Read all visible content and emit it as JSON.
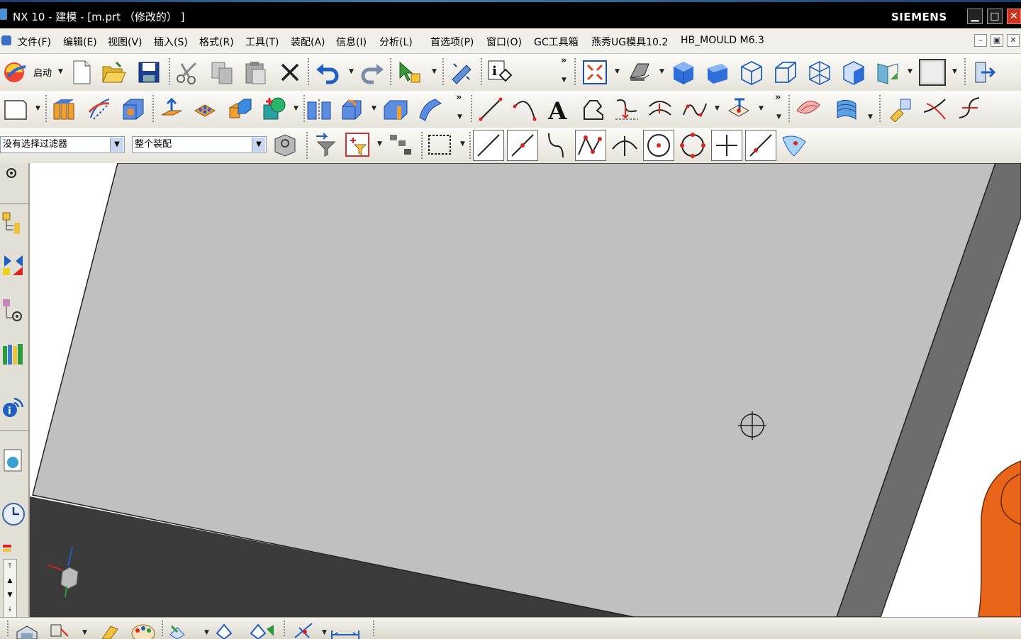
{
  "window": {
    "title": "NX 10 - 建模 - [m.prt （修改的） ]",
    "brand": "SIEMENS",
    "controls": [
      "minimize",
      "maximize",
      "close"
    ]
  },
  "menu": {
    "items": [
      "文件(F)",
      "编辑(E)",
      "视图(V)",
      "插入(S)",
      "格式(R)",
      "工具(T)",
      "装配(A)",
      "信息(I)",
      "分析(L)",
      "首选项(P)",
      "窗口(O)",
      "GC工具箱",
      "燕秀UG模具10.2",
      "HB_MOULD M6.3"
    ]
  },
  "toolbar": {
    "start_label": "启动",
    "more": "»"
  },
  "selection": {
    "filter": "没有选择过滤器",
    "scope": "整个装配"
  },
  "icons": {
    "toolbar1": [
      "start-icon",
      "new-icon",
      "open-icon",
      "save-icon",
      "cut-icon",
      "copy-icon",
      "paste-icon",
      "delete-icon",
      "undo-icon",
      "redo-icon",
      "select-icon",
      "command-finder-icon",
      "info-icon",
      "fit-icon",
      "render-style-icon",
      "view-iso-shaded-icon",
      "view-trimetric-icon",
      "view-wireframe-icon",
      "view-front-icon",
      "view-right-icon",
      "view-top-icon",
      "section-view-icon",
      "background-icon",
      "exit-icon"
    ],
    "toolbar2": [
      "sketch-icon",
      "extrude-icon",
      "revolve-icon",
      "block-icon",
      "pull-face-icon",
      "pattern-icon",
      "unite-icon",
      "hole-icon",
      "mirror-icon",
      "edge-blend-icon",
      "chamfer-icon",
      "swept-icon",
      "line-icon",
      "arc-icon",
      "text-icon",
      "region-icon",
      "project-curve-icon",
      "offset-curve-icon",
      "studio-spline-icon",
      "point-icon",
      "surface-icon",
      "trim-body-icon",
      "measure-icon",
      "trim-curve-icon",
      "divide-icon"
    ],
    "toolbar3": [
      "filter-icon",
      "select-features-icon",
      "snap-endpoint-icon",
      "snap-midpoint-icon",
      "snap-control-icon",
      "snap-intersection-icon",
      "snap-center-icon",
      "snap-quadrant-icon",
      "snap-existing-icon",
      "snap-on-curve-icon",
      "snap-face-icon"
    ],
    "resource_bar": [
      "roles-icon",
      "assembly-navigator-icon",
      "constraint-icon",
      "part-navigator-icon",
      "reuse-library-icon",
      "web-browser-icon",
      "history-icon",
      "process-studio-icon"
    ]
  },
  "colors": {
    "title_bg": "#000000",
    "menu_bg": "#f0efea",
    "plate_face": "#c0c0c0",
    "plate_side": "#6d6d6d",
    "plate_dark": "#3a3a3a",
    "part_orange": "#e8651a",
    "close_red": "#c8341e"
  }
}
